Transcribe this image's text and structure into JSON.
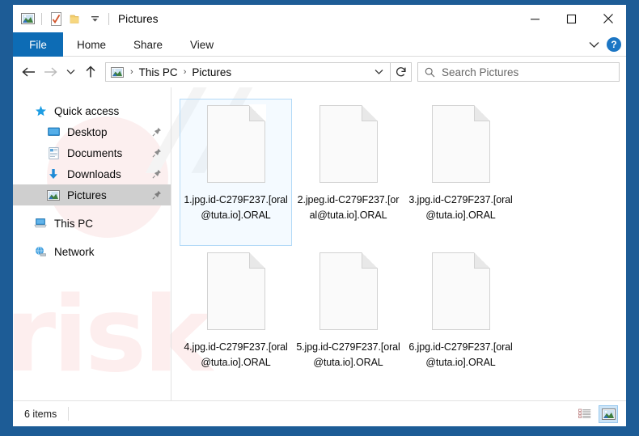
{
  "window": {
    "title": "Pictures",
    "quick_access_toolbar": [
      {
        "name": "pictures-folder-icon",
        "label": "Pictures"
      },
      {
        "name": "properties-icon",
        "label": "Properties"
      },
      {
        "name": "new-folder-icon",
        "label": "New folder"
      },
      {
        "name": "customize-chevron-icon",
        "label": "Customize Quick Access Toolbar"
      }
    ],
    "caption_buttons": {
      "minimize": "Minimize",
      "maximize": "Maximize",
      "close": "Close"
    }
  },
  "ribbon": {
    "tabs": [
      {
        "label": "File",
        "active": true
      },
      {
        "label": "Home",
        "active": false
      },
      {
        "label": "Share",
        "active": false
      },
      {
        "label": "View",
        "active": false
      }
    ],
    "collapse_label": "Minimize the Ribbon",
    "help_label": "?"
  },
  "navigation": {
    "back_label": "Back",
    "forward_label": "Forward",
    "recent_label": "Recent locations",
    "up_label": "Up",
    "breadcrumbs": [
      "This PC",
      "Pictures"
    ],
    "breadcrumb_separator": "›",
    "address_dropdown_label": "Previous locations",
    "refresh_label": "Refresh"
  },
  "search": {
    "placeholder": "Search Pictures",
    "value": ""
  },
  "sidebar": {
    "items": [
      {
        "label": "Quick access",
        "icon": "star-icon",
        "level": 0,
        "pinned": false,
        "selected": false
      },
      {
        "label": "Desktop",
        "icon": "desktop-icon",
        "level": 1,
        "pinned": true,
        "selected": false
      },
      {
        "label": "Documents",
        "icon": "documents-icon",
        "level": 1,
        "pinned": true,
        "selected": false
      },
      {
        "label": "Downloads",
        "icon": "downloads-icon",
        "level": 1,
        "pinned": true,
        "selected": false
      },
      {
        "label": "Pictures",
        "icon": "pictures-icon",
        "level": 1,
        "pinned": true,
        "selected": true
      },
      {
        "label": "This PC",
        "icon": "this-pc-icon",
        "level": 0,
        "pinned": false,
        "selected": false
      },
      {
        "label": "Network",
        "icon": "network-icon",
        "level": 0,
        "pinned": false,
        "selected": false
      }
    ]
  },
  "files": [
    {
      "name": "1.jpg.id-C279F237.[oral@tuta.io].ORAL",
      "icon": "generic-file-icon",
      "selected": true
    },
    {
      "name": "2.jpeg.id-C279F237.[oral@tuta.io].ORAL",
      "icon": "generic-file-icon",
      "selected": false
    },
    {
      "name": "3.jpg.id-C279F237.[oral@tuta.io].ORAL",
      "icon": "generic-file-icon",
      "selected": false
    },
    {
      "name": "4.jpg.id-C279F237.[oral@tuta.io].ORAL",
      "icon": "generic-file-icon",
      "selected": false
    },
    {
      "name": "5.jpg.id-C279F237.[oral@tuta.io].ORAL",
      "icon": "generic-file-icon",
      "selected": false
    },
    {
      "name": "6.jpg.id-C279F237.[oral@tuta.io].ORAL",
      "icon": "generic-file-icon",
      "selected": false
    }
  ],
  "status": {
    "item_count": "6 items",
    "view_details_label": "Details view",
    "view_large_icons_label": "Large icons view",
    "active_view": "large-icons"
  },
  "watermark": {
    "text_primary": "risk",
    "text_secondary": "//"
  },
  "colors": {
    "window_border": "#1d5c96",
    "file_tab": "#0d6cb5",
    "help_button": "#1c76c4",
    "selection_border": "#b4daf7",
    "sidebar_selected": "#cfcfcf",
    "view_active": "#cce4f7"
  }
}
